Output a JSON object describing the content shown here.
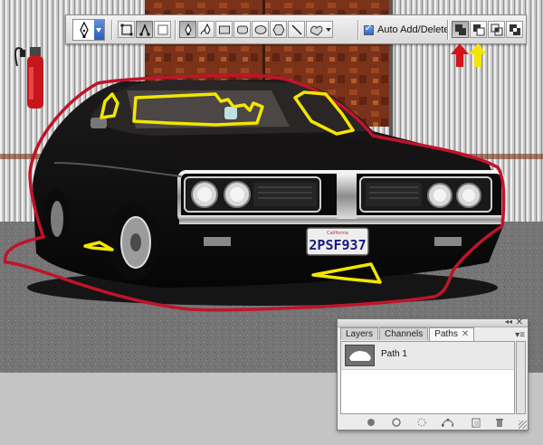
{
  "toolbar": {
    "auto_add_label": "Auto Add/Delete",
    "auto_add_checked": true,
    "tools": [
      "pen-icon",
      "freeform-pen-icon",
      "rectangle-icon",
      "rounded-rectangle-icon",
      "ellipse-icon",
      "polygon-icon",
      "line-icon",
      "custom-shape-icon"
    ],
    "modes": [
      "shape-layers-icon",
      "paths-icon",
      "fill-pixels-icon"
    ],
    "path_operations": [
      "add-to-path-area-icon",
      "subtract-from-path-area-icon",
      "intersect-path-areas-icon",
      "exclude-overlapping-path-areas-icon"
    ]
  },
  "photo": {
    "license_plate": "2PSF937",
    "selection_color": "#c0142a",
    "highlight_color": "#f2e600"
  },
  "annotations": {
    "red_arrow_color": "#d4141c",
    "yellow_arrow_color": "#f2e600"
  },
  "panel": {
    "tabs": [
      {
        "label": "Layers",
        "active": false
      },
      {
        "label": "Channels",
        "active": false
      },
      {
        "label": "Paths",
        "active": true
      }
    ],
    "close_glyph": "✕",
    "tab_close_glyph": "✕",
    "collapse_glyph": "◂◂",
    "menu_glyph": "▾≡",
    "paths": [
      {
        "name": "Path 1"
      }
    ],
    "footer_buttons": [
      "fill-path-icon",
      "stroke-path-icon",
      "load-path-as-selection-icon",
      "make-work-path-icon",
      "new-path-icon",
      "delete-path-icon"
    ]
  }
}
